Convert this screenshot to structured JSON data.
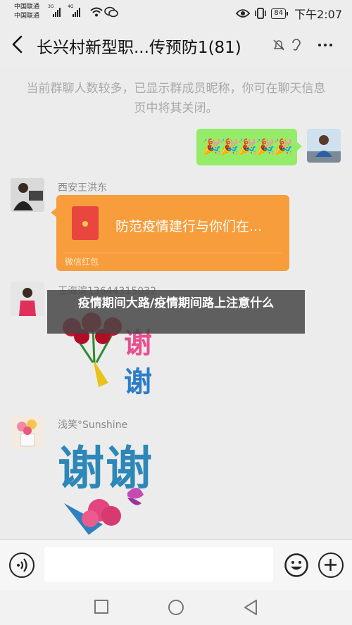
{
  "status_bar": {
    "carrier_1": "中国联通",
    "carrier_2": "中国联通",
    "signal_1_type": "3G",
    "signal_2_type": "4G",
    "battery": "84",
    "time": "下午2:07"
  },
  "header": {
    "title": "长兴村新型职...传预防1(81)"
  },
  "system_notice": "当前群聊人数较多，已显示群成员昵称，你可在聊天信息页中将其关闭。",
  "messages": [
    {
      "type": "self_emoji",
      "content": "🎉🎉🎉🎉🎉"
    },
    {
      "type": "red_packet",
      "sender": "西安王洪东",
      "title": "防范疫情建行与你们在...",
      "label": "微信红包"
    },
    {
      "type": "sticker",
      "sender": "王海滨13644315032",
      "sticker_text": [
        "谢",
        "谢"
      ]
    },
    {
      "type": "sticker",
      "sender": "浅笑°Sunshine",
      "sticker_text": "谢谢"
    }
  ],
  "overlay": {
    "text": "疫情期间大路/疫情期间路上注意什么"
  },
  "input_bar": {
    "placeholder": ""
  },
  "colors": {
    "self_bubble": "#95ec69",
    "red_packet": "#f79d3b",
    "background": "#ececec"
  }
}
